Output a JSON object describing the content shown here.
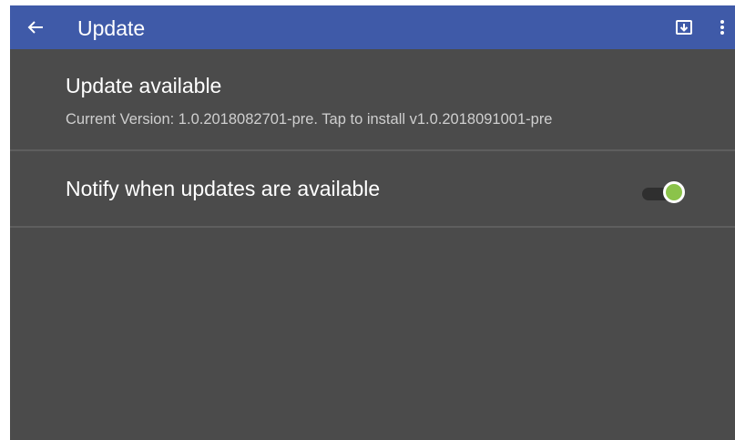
{
  "app_bar": {
    "title": "Update",
    "back_icon": "arrow-left-icon",
    "download_icon": "system-update-icon",
    "overflow_icon": "more-vert-icon",
    "color": "#3f5aa8"
  },
  "preferences": {
    "update": {
      "title": "Update available",
      "summary": "Current Version: 1.0.2018082701-pre. Tap to install v1.0.2018091001-pre"
    },
    "notify": {
      "title": "Notify when updates are available",
      "enabled": true,
      "accent_color": "#8bc34a"
    }
  },
  "theme": {
    "background": "#4b4b4b",
    "text": "#ffffff",
    "secondary_text": "#cfcfcf"
  }
}
